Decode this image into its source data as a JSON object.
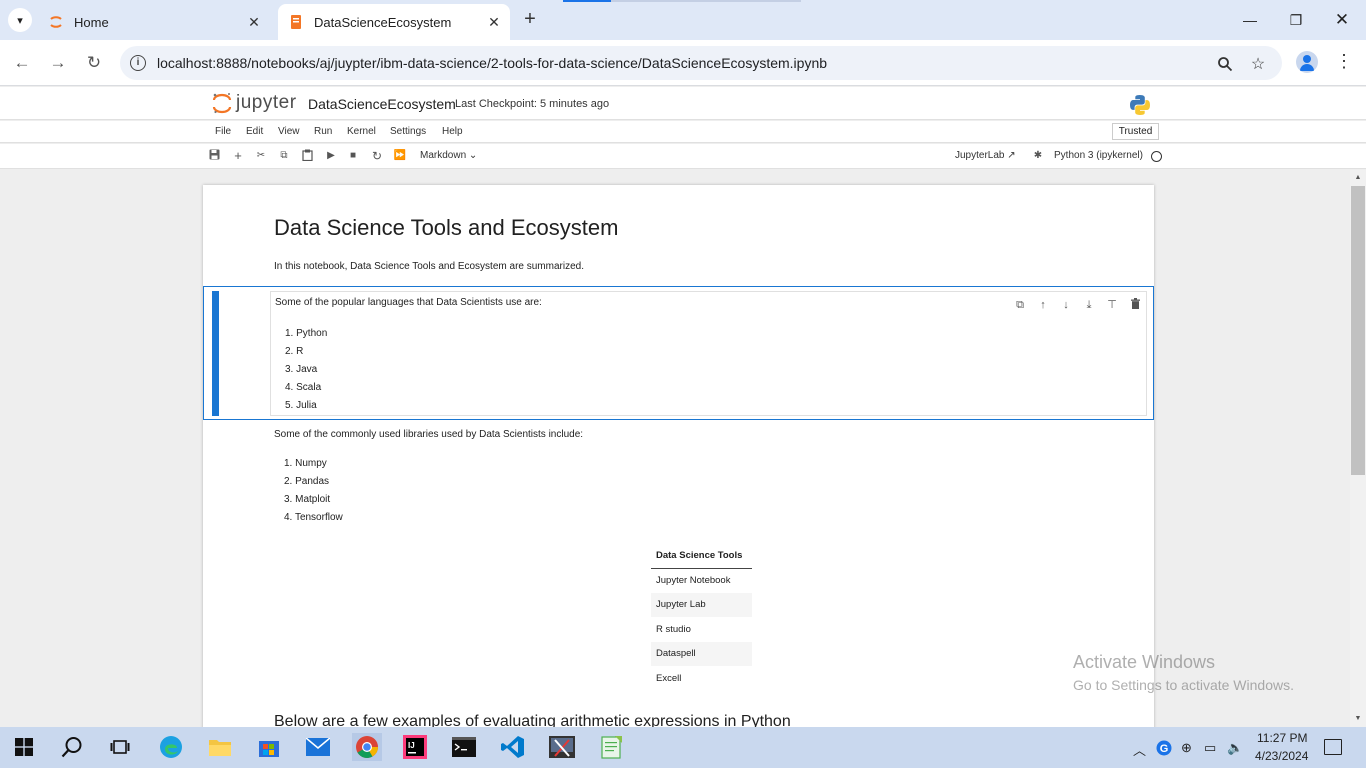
{
  "browser": {
    "tabs": [
      {
        "label": "Home",
        "icon": "jupyter-favicon-icon"
      },
      {
        "label": "DataScienceEcosystem",
        "icon": "notebook-favicon-icon"
      }
    ],
    "url": "localhost:8888/notebooks/aj/juypter/ibm-data-science/2-tools-for-data-science/DataScienceEcosystem.ipynb"
  },
  "jupyter": {
    "logo_text": "jupyter",
    "notebook_title": "DataScienceEcosystem",
    "checkpoint": "Last Checkpoint: 5 minutes ago",
    "menu": [
      "File",
      "Edit",
      "View",
      "Run",
      "Kernel",
      "Settings",
      "Help"
    ],
    "trusted": "Trusted",
    "cell_type": "Markdown",
    "jupyterlab_link": "JupyterLab",
    "kernel": "Python 3 (ipykernel)"
  },
  "notebook": {
    "title": "Data Science Tools and Ecosystem",
    "intro": "In this notebook, Data Science Tools and Ecosystem are summarized.",
    "languages_intro": "Some of the popular languages that Data Scientists use are:",
    "languages": [
      "1. Python",
      "2. R",
      "3. Java",
      "4. Scala",
      "5. Julia"
    ],
    "libraries_intro": "Some of the commonly used libraries used by Data Scientists include:",
    "libraries": [
      "1. Numpy",
      "2. Pandas",
      "3. Matploit",
      "4. Tensorflow"
    ],
    "table_header": "Data Science Tools",
    "tools": [
      "Jupyter Notebook",
      "Jupyter Lab",
      "R studio",
      "Dataspell",
      "Excell"
    ],
    "arithmetic_heading": "Below are a few examples of evaluating arithmetic expressions in Python"
  },
  "watermark": {
    "line1": "Activate Windows",
    "line2": "Go to Settings to activate Windows."
  },
  "taskbar": {
    "time": "11:27 PM",
    "date": "4/23/2024"
  },
  "colors": {
    "accent": "#1976d2",
    "tabstrip": "#dfe8f7",
    "taskbar": "#c9d8ee"
  }
}
